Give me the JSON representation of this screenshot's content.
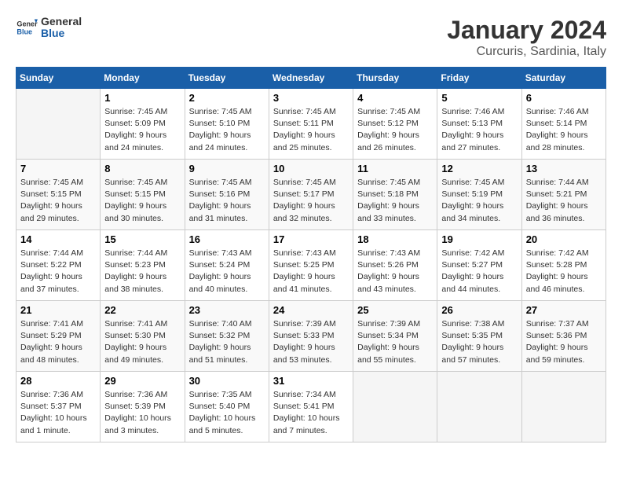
{
  "header": {
    "logo_general": "General",
    "logo_blue": "Blue",
    "title": "January 2024",
    "subtitle": "Curcuris, Sardinia, Italy"
  },
  "weekdays": [
    "Sunday",
    "Monday",
    "Tuesday",
    "Wednesday",
    "Thursday",
    "Friday",
    "Saturday"
  ],
  "weeks": [
    [
      {
        "day": "",
        "info": ""
      },
      {
        "day": "1",
        "info": "Sunrise: 7:45 AM\nSunset: 5:09 PM\nDaylight: 9 hours\nand 24 minutes."
      },
      {
        "day": "2",
        "info": "Sunrise: 7:45 AM\nSunset: 5:10 PM\nDaylight: 9 hours\nand 24 minutes."
      },
      {
        "day": "3",
        "info": "Sunrise: 7:45 AM\nSunset: 5:11 PM\nDaylight: 9 hours\nand 25 minutes."
      },
      {
        "day": "4",
        "info": "Sunrise: 7:45 AM\nSunset: 5:12 PM\nDaylight: 9 hours\nand 26 minutes."
      },
      {
        "day": "5",
        "info": "Sunrise: 7:46 AM\nSunset: 5:13 PM\nDaylight: 9 hours\nand 27 minutes."
      },
      {
        "day": "6",
        "info": "Sunrise: 7:46 AM\nSunset: 5:14 PM\nDaylight: 9 hours\nand 28 minutes."
      }
    ],
    [
      {
        "day": "7",
        "info": "Sunrise: 7:45 AM\nSunset: 5:15 PM\nDaylight: 9 hours\nand 29 minutes."
      },
      {
        "day": "8",
        "info": "Sunrise: 7:45 AM\nSunset: 5:15 PM\nDaylight: 9 hours\nand 30 minutes."
      },
      {
        "day": "9",
        "info": "Sunrise: 7:45 AM\nSunset: 5:16 PM\nDaylight: 9 hours\nand 31 minutes."
      },
      {
        "day": "10",
        "info": "Sunrise: 7:45 AM\nSunset: 5:17 PM\nDaylight: 9 hours\nand 32 minutes."
      },
      {
        "day": "11",
        "info": "Sunrise: 7:45 AM\nSunset: 5:18 PM\nDaylight: 9 hours\nand 33 minutes."
      },
      {
        "day": "12",
        "info": "Sunrise: 7:45 AM\nSunset: 5:19 PM\nDaylight: 9 hours\nand 34 minutes."
      },
      {
        "day": "13",
        "info": "Sunrise: 7:44 AM\nSunset: 5:21 PM\nDaylight: 9 hours\nand 36 minutes."
      }
    ],
    [
      {
        "day": "14",
        "info": "Sunrise: 7:44 AM\nSunset: 5:22 PM\nDaylight: 9 hours\nand 37 minutes."
      },
      {
        "day": "15",
        "info": "Sunrise: 7:44 AM\nSunset: 5:23 PM\nDaylight: 9 hours\nand 38 minutes."
      },
      {
        "day": "16",
        "info": "Sunrise: 7:43 AM\nSunset: 5:24 PM\nDaylight: 9 hours\nand 40 minutes."
      },
      {
        "day": "17",
        "info": "Sunrise: 7:43 AM\nSunset: 5:25 PM\nDaylight: 9 hours\nand 41 minutes."
      },
      {
        "day": "18",
        "info": "Sunrise: 7:43 AM\nSunset: 5:26 PM\nDaylight: 9 hours\nand 43 minutes."
      },
      {
        "day": "19",
        "info": "Sunrise: 7:42 AM\nSunset: 5:27 PM\nDaylight: 9 hours\nand 44 minutes."
      },
      {
        "day": "20",
        "info": "Sunrise: 7:42 AM\nSunset: 5:28 PM\nDaylight: 9 hours\nand 46 minutes."
      }
    ],
    [
      {
        "day": "21",
        "info": "Sunrise: 7:41 AM\nSunset: 5:29 PM\nDaylight: 9 hours\nand 48 minutes."
      },
      {
        "day": "22",
        "info": "Sunrise: 7:41 AM\nSunset: 5:30 PM\nDaylight: 9 hours\nand 49 minutes."
      },
      {
        "day": "23",
        "info": "Sunrise: 7:40 AM\nSunset: 5:32 PM\nDaylight: 9 hours\nand 51 minutes."
      },
      {
        "day": "24",
        "info": "Sunrise: 7:39 AM\nSunset: 5:33 PM\nDaylight: 9 hours\nand 53 minutes."
      },
      {
        "day": "25",
        "info": "Sunrise: 7:39 AM\nSunset: 5:34 PM\nDaylight: 9 hours\nand 55 minutes."
      },
      {
        "day": "26",
        "info": "Sunrise: 7:38 AM\nSunset: 5:35 PM\nDaylight: 9 hours\nand 57 minutes."
      },
      {
        "day": "27",
        "info": "Sunrise: 7:37 AM\nSunset: 5:36 PM\nDaylight: 9 hours\nand 59 minutes."
      }
    ],
    [
      {
        "day": "28",
        "info": "Sunrise: 7:36 AM\nSunset: 5:37 PM\nDaylight: 10 hours\nand 1 minute."
      },
      {
        "day": "29",
        "info": "Sunrise: 7:36 AM\nSunset: 5:39 PM\nDaylight: 10 hours\nand 3 minutes."
      },
      {
        "day": "30",
        "info": "Sunrise: 7:35 AM\nSunset: 5:40 PM\nDaylight: 10 hours\nand 5 minutes."
      },
      {
        "day": "31",
        "info": "Sunrise: 7:34 AM\nSunset: 5:41 PM\nDaylight: 10 hours\nand 7 minutes."
      },
      {
        "day": "",
        "info": ""
      },
      {
        "day": "",
        "info": ""
      },
      {
        "day": "",
        "info": ""
      }
    ]
  ]
}
